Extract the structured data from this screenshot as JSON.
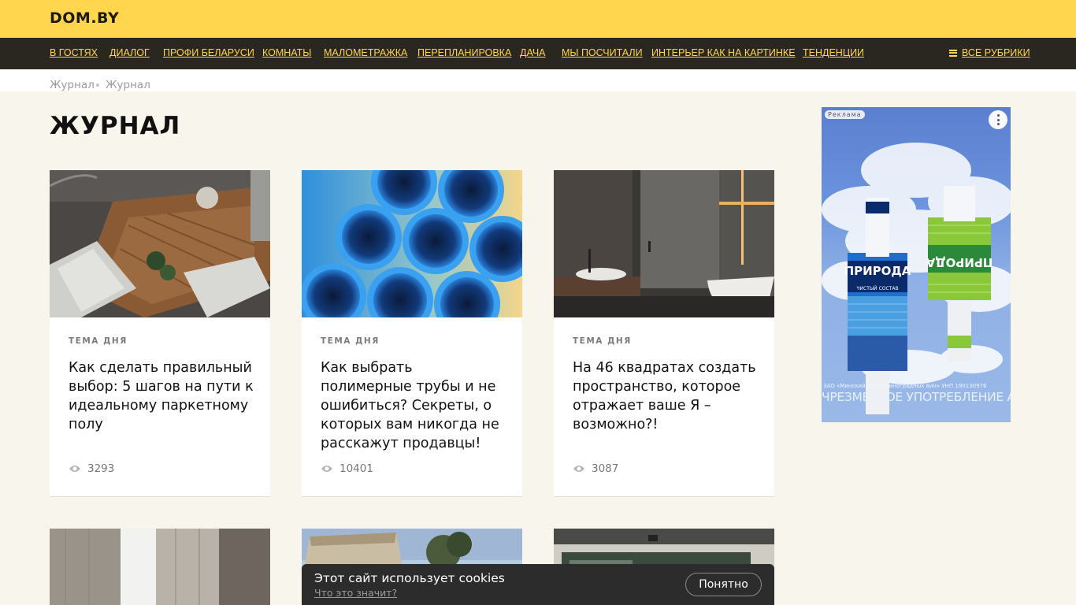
{
  "header": {
    "logo": "DOM.BY"
  },
  "nav": {
    "items": [
      "В гостях",
      "Диалог",
      "Профи Беларуси",
      "Комнаты",
      "Малометражка",
      "Перепланировка",
      "Дача",
      "Мы посчитали",
      "Интерьер как на картинке",
      "Тенденции"
    ],
    "all_rubrics": "Все рубрики",
    "all_rubrics_icon": "hamburger-icon"
  },
  "breadcrumbs": [
    "Журнал",
    "Журнал"
  ],
  "page_title": "Журнал",
  "cards": [
    {
      "tag": "Тема дня",
      "title": "Как сделать правильный выбор: 5 шагов на пути к идеальному паркетному полу",
      "views": "3293",
      "image": "living-room-parquet-photo"
    },
    {
      "tag": "Тема дня",
      "title": "Как выбрать полимерные трубы и не ошибиться? Секреты, о которых вам никогда не расскажут продавцы!",
      "views": "10401",
      "image": "blue-pipes-photo"
    },
    {
      "tag": "Тема дня",
      "title": "На 46 квадратах создать пространство, которое отражает ваше Я – возможно?!",
      "views": "3087",
      "image": "bathroom-interior-photo"
    }
  ],
  "ad": {
    "label": "Реклама",
    "brand": "ПРИРОДА",
    "product_line": "ЧИСТЫЙ СОСТАВ",
    "small_print": "ЗАО «Минский завод виноградных вин» УНП 190130976",
    "warning": "ЧРЕЗМЕРНОЕ УПОТРЕБЛЕНИЕ АЛКОГОЛЯ ВРЕДИТ ВАШЕМУ ЗДОРОВЬЮ"
  },
  "cookie": {
    "message": "Этот сайт использует cookies",
    "link": "Что это значит?",
    "button": "Понятно"
  },
  "colors": {
    "brand_yellow": "#ffd64d",
    "nav_dark": "#2a2720",
    "page_bg": "#f8f5ed"
  }
}
